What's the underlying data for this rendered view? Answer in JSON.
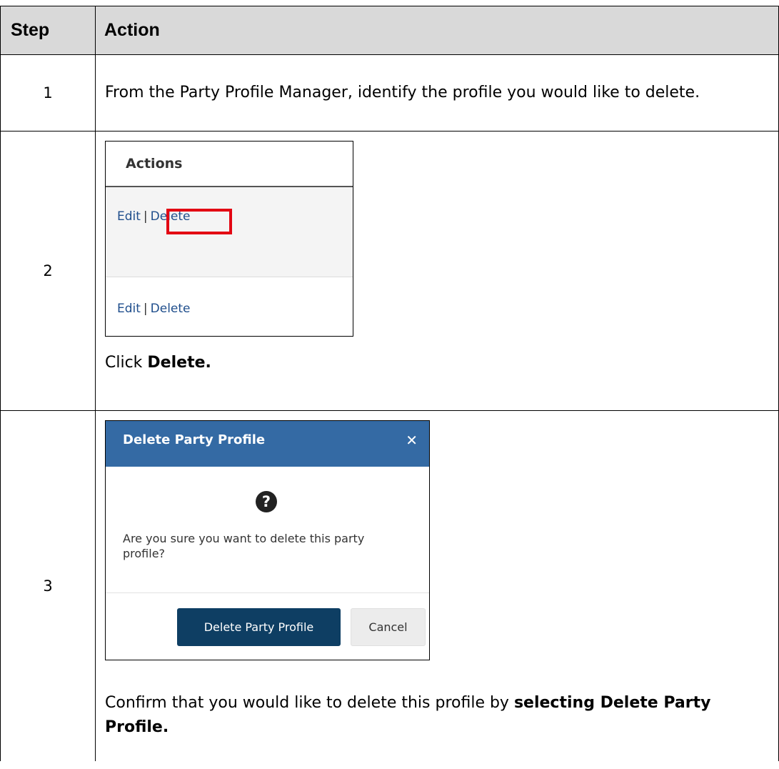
{
  "table": {
    "header": {
      "step": "Step",
      "action": "Action"
    },
    "rows": [
      {
        "step": "1",
        "text": "From the Party Profile Manager, identify the profile you would like to delete."
      },
      {
        "step": "2",
        "actions_panel": {
          "title": "Actions",
          "rows": [
            {
              "edit": "Edit",
              "separator": "|",
              "delete": "Delete",
              "highlighted": "Delete"
            },
            {
              "edit": "Edit",
              "separator": "|",
              "delete": "Delete"
            }
          ]
        },
        "instruction_prefix": "Click ",
        "instruction_bold": "Delete."
      },
      {
        "step": "3",
        "dialog": {
          "title": "Delete Party Profile",
          "close_glyph": "✕",
          "icon": "question-circle-icon",
          "icon_glyph": "?",
          "message": "Are you sure you want to delete this party profile?",
          "primary_button": "Delete Party Profile",
          "secondary_button": "Cancel",
          "title_bar_color": "#346aa4",
          "primary_button_color": "#0e3e63"
        },
        "confirm_prefix": "Confirm that you would like to delete this profile by ",
        "confirm_bold": "selecting Delete Party Profile."
      }
    ],
    "header_background": "#d9d9d9",
    "highlight_color": "#e30613"
  }
}
